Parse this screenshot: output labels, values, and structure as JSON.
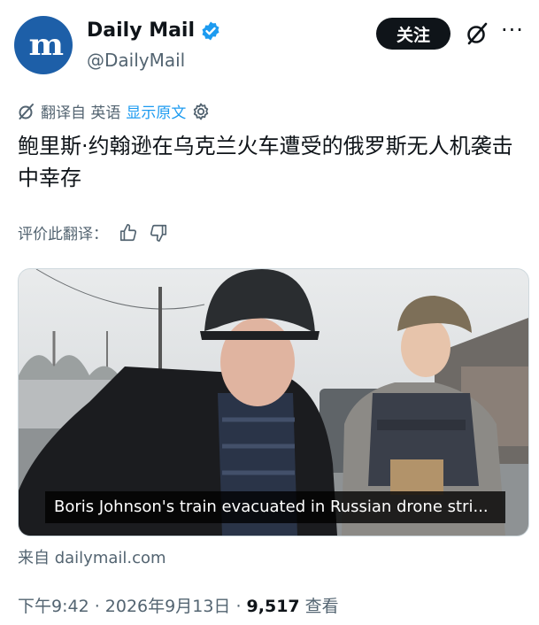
{
  "post": {
    "author_name": "Daily Mail",
    "avatar_text": "m",
    "handle": "@DailyMail",
    "follow_label": "关注",
    "more_label": "···",
    "translated_from": "翻译自 英语",
    "show_original": "显示原文",
    "text": "鲍里斯·约翰逊在乌克兰火车遭受的俄罗斯无人机袭击中幸存",
    "rate_translation": "评价此翻译：",
    "media_caption": "Boris Johnson's train evacuated in Russian drone stri...",
    "source": "来自 dailymail.com",
    "time": "下午9:42 · 2026年9月13日 · ",
    "views_count": "9,517",
    "views_label": " 查看"
  },
  "colors": {
    "brand": "#1d5fa8",
    "link": "#1d9bf0",
    "verified": "#1d9bf0"
  },
  "icons": [
    "verified-badge-icon",
    "grok-icon",
    "more-icon",
    "translate-icon",
    "settings-icon",
    "thumbs-up-icon",
    "thumbs-down-icon"
  ]
}
